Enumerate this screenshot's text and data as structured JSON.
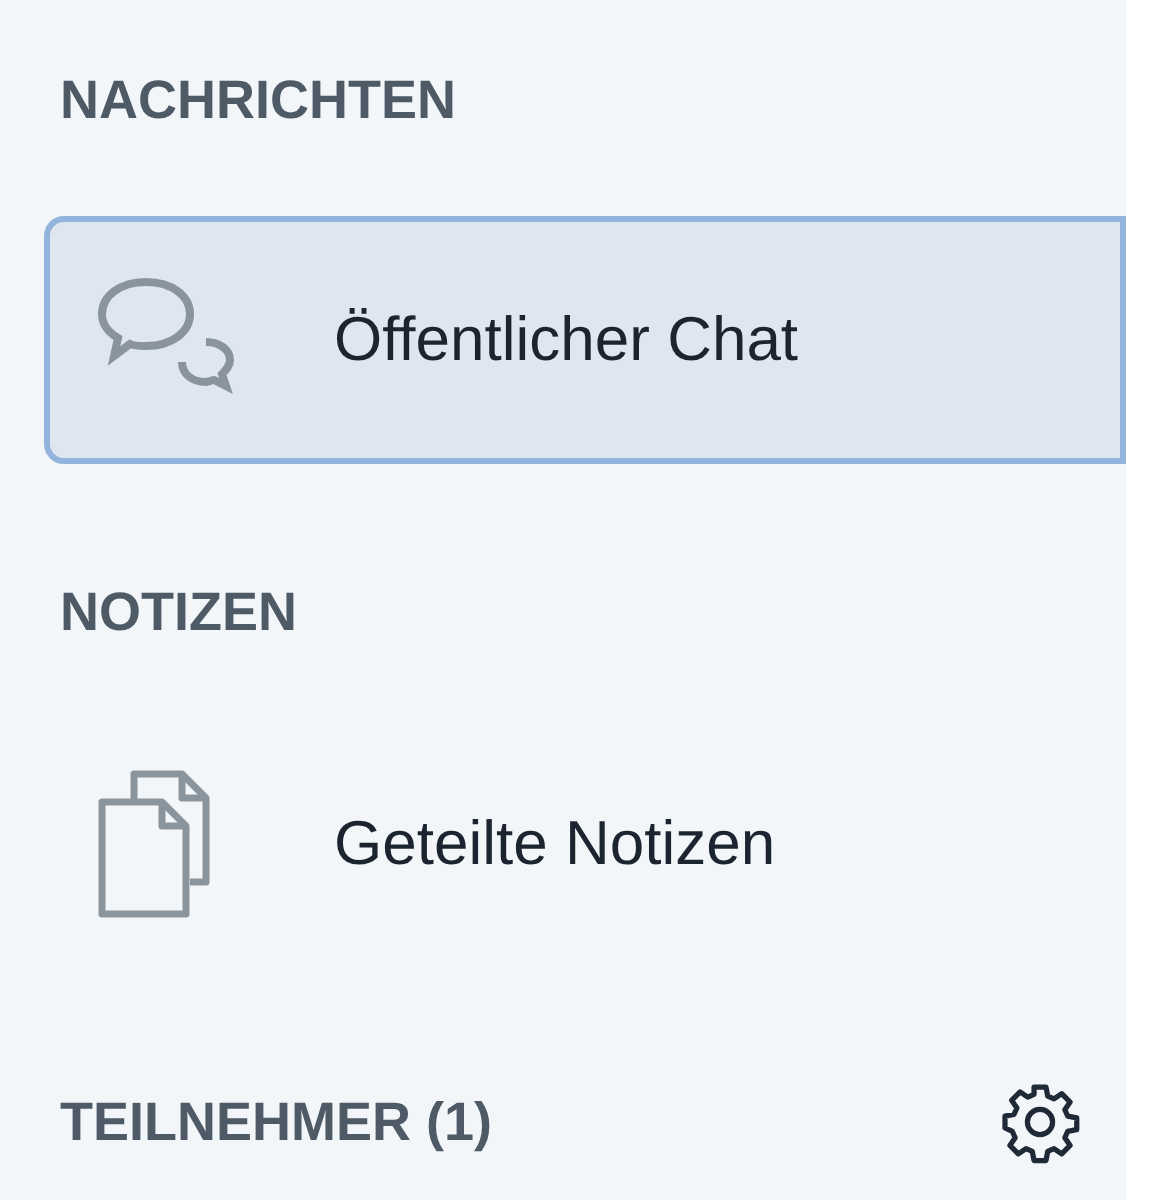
{
  "sections": [
    {
      "title": "NACHRICHTEN",
      "items": [
        {
          "kind": "chat",
          "label": "Öffentlicher Chat",
          "selected": true
        }
      ]
    },
    {
      "title": "NOTIZEN",
      "items": [
        {
          "kind": "notes",
          "label": "Geteilte Notizen",
          "selected": false
        }
      ]
    },
    {
      "title": "TEILNEHMER (1)",
      "settings": true
    }
  ]
}
